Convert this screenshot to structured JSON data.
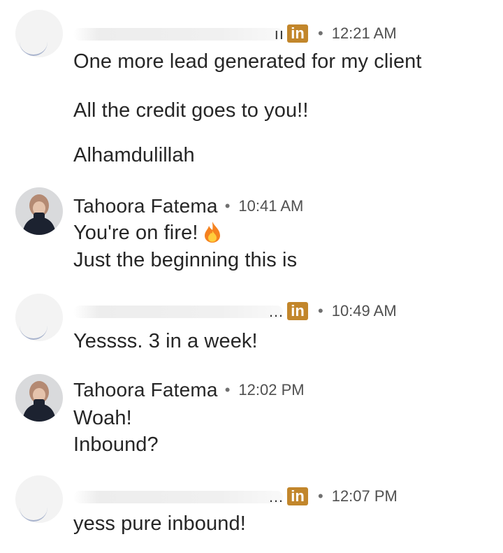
{
  "messages": [
    {
      "sender": "",
      "redacted": true,
      "badge": "in",
      "time": "12:21 AM",
      "lines": [
        "One more lead generated for my client",
        "All the credit goes to you!!",
        "Alhamdulillah"
      ]
    },
    {
      "sender": "Tahoora Fatema",
      "redacted": false,
      "time": "10:41 AM",
      "lines": [
        "You're on fire!",
        "Just the beginning this is"
      ],
      "emoji": "fire-emoji"
    },
    {
      "sender": "",
      "redacted": true,
      "badge": "in",
      "time": "10:49 AM",
      "lines": [
        "Yessss. 3 in a week!"
      ]
    },
    {
      "sender": "Tahoora Fatema",
      "redacted": false,
      "time": "12:02 PM",
      "lines": [
        "Woah!",
        "Inbound?"
      ]
    },
    {
      "sender": "",
      "redacted": true,
      "badge": "in",
      "time": "12:07 PM",
      "lines": [
        "yess pure inbound!"
      ]
    }
  ],
  "colors": {
    "badge": "#c2862b",
    "text": "#262626",
    "meta": "#505050"
  }
}
